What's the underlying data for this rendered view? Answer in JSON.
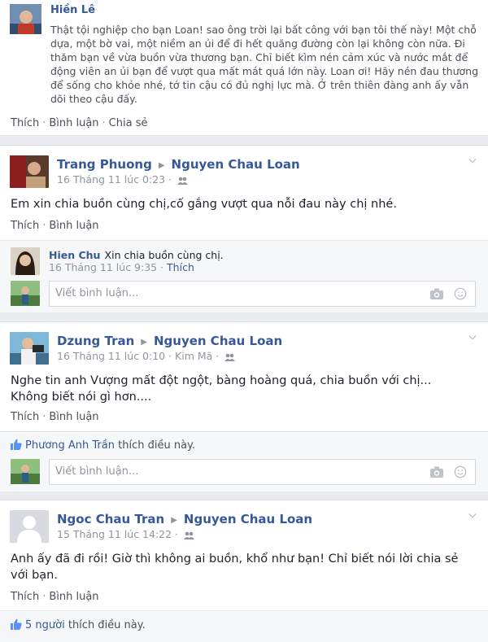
{
  "comment_top": {
    "author": "Hiền Lê",
    "text": "Thật tội nghiệp cho bạn Loan! sao ông trời lại bất công với bạn tôi thế này! Một chỗ dựa, một bờ vai, một niềm an ủi để đi hết quãng đường còn lại không còn nữa. Đi thăm bạn về vừa buồn vừa thương bạn. Chỉ biết kìm nén cảm xúc và nước mắt để động viên an ủi bạn để vượt qua mất mát quá lớn này. Loan ơi! Hãy nén đau thương để sống cho khỏe nhé, tớ tin cậu có đủ nghị lực mà. Ở trên thiên đàng anh ấy vẫn dõi theo cậu đấy.",
    "actions": [
      "Thích",
      "Bình luận",
      "Chia sẻ"
    ]
  },
  "posts": [
    {
      "author": "Trang Phuong",
      "target": "Nguyen Chau Loan",
      "time": "16 Tháng 11 lúc 0:23",
      "text": "Em xin chia buồn cùng chị,cố gắng vượt qua nỗi đau này chị nhé.",
      "actions": [
        "Thích",
        "Bình luận"
      ],
      "reply": {
        "author": "Hien Chu",
        "text": "Xin chia buồn cùng chị.",
        "time": "16 Tháng 11 lúc 9:35",
        "like": "Thích"
      },
      "comment_placeholder": "Viết bình luận..."
    },
    {
      "author": "Dzung Tran",
      "target": "Nguyen Chau Loan",
      "time": "16 Tháng 11 lúc 0:10",
      "place": "Kim Mã",
      "text_line1": "Nghe tin anh Vượng mất đột ngột, bàng hoàng quá, chia buồn với chị...",
      "text_line2": "Không biết nói gì hơn....",
      "actions": [
        "Thích",
        "Bình luận"
      ],
      "liker": "Phương Anh Trần",
      "likes_suffix": "thích điều này.",
      "comment_placeholder": "Viết bình luận..."
    },
    {
      "author": "Ngoc Chau Tran",
      "target": "Nguyen Chau Loan",
      "time": "15 Tháng 11 lúc 14:22",
      "text_line1": "Anh ấy đã đi rồi! Giờ thì không ai buồn, khổ như bạn! Chỉ biết nói lời chia sẻ",
      "text_line2": "với bạn.",
      "actions": [
        "Thích",
        "Bình luận"
      ],
      "likes_count": "5 người",
      "likes_suffix": "thích điều này."
    }
  ],
  "colors": {
    "link": "#365899",
    "meta": "#90949c",
    "background": "#e9ebee"
  }
}
